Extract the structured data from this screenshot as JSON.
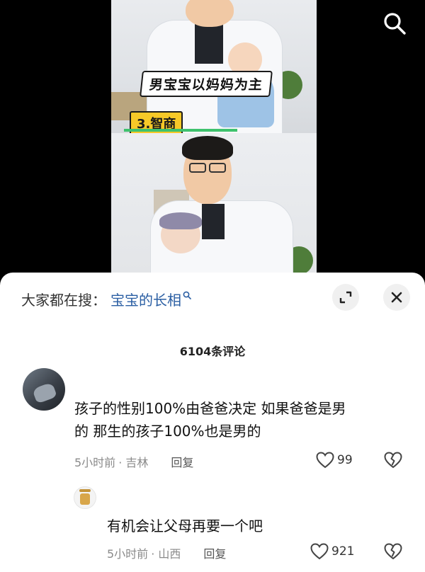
{
  "video": {
    "caption": "男宝宝以妈妈为主",
    "tag": "3.智商"
  },
  "search": {
    "prefix": "大家都在搜：",
    "term": "宝宝的长相",
    "icon": "search-icon"
  },
  "comments": {
    "count_label": "6104条评论",
    "items": [
      {
        "text_line1": "孩子的性别100%由爸爸决定 如果爸爸是男",
        "text_line2": "的 那生的孩子100%也是男的",
        "time": "5小时前",
        "location": "· 吉林",
        "reply_label": "回复",
        "likes": "99"
      },
      {
        "text": "有机会让父母再要一个吧",
        "time": "5小时前",
        "location": "· 山西",
        "reply_label": "回复",
        "likes": "921"
      }
    ]
  },
  "colors": {
    "search_term": "#2a5ea3",
    "caption_bg": "#ffffff",
    "tag_bg": "#f7c928",
    "meta_text": "#8a8a8a"
  }
}
